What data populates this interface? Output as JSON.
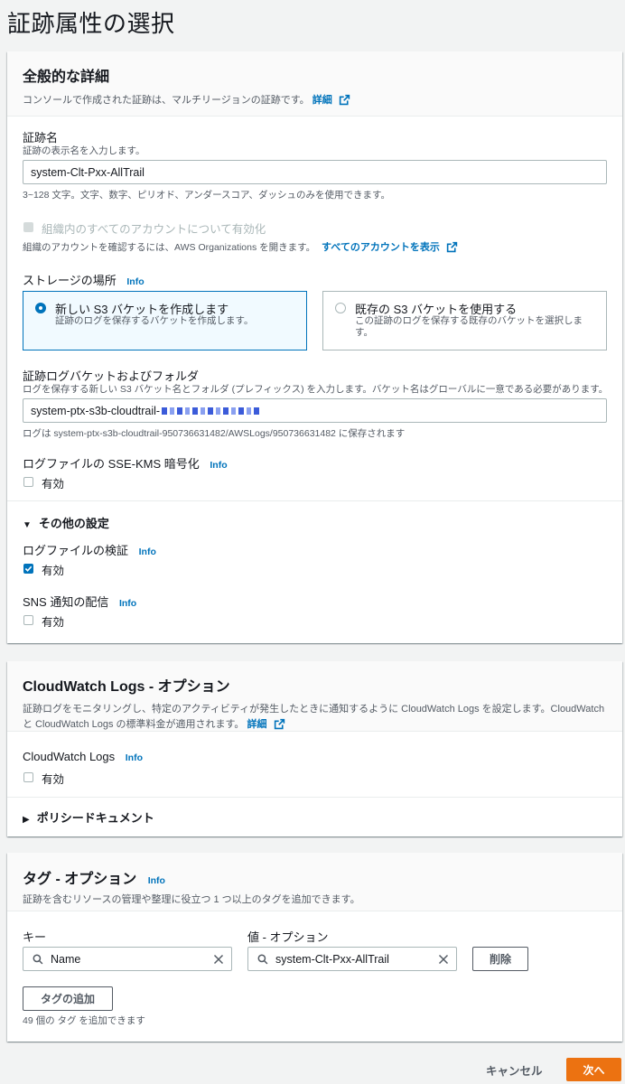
{
  "page": {
    "title": "証跡属性の選択"
  },
  "general": {
    "title": "全般的な詳細",
    "desc": "コンソールで作成された証跡は、マルチリージョンの証跡です。",
    "detail_link": "詳細",
    "trail_name_label": "証跡名",
    "trail_name_desc": "証跡の表示名を入力します。",
    "trail_name_value": "system-Clt-Pxx-AllTrail",
    "trail_name_hint": "3~128 文字。文字、数字、ピリオド、アンダースコア、ダッシュのみを使用できます。",
    "org_checkbox_label": "組織内のすべてのアカウントについて有効化",
    "org_desc": "組織のアカウントを確認するには、AWS Organizations を開きます。",
    "org_link": "すべてのアカウントを表示",
    "storage_label": "ストレージの場所",
    "info": "Info",
    "storage_options": [
      {
        "title": "新しい S3 バケットを作成します",
        "desc": "証跡のログを保存するバケットを作成します。",
        "selected": true
      },
      {
        "title": "既存の S3 バケットを使用する",
        "desc": "この証跡のログを保存する既存のバケットを選択します。",
        "selected": false
      }
    ],
    "bucket_label": "証跡ログバケットおよびフォルダ",
    "bucket_desc": "ログを保存する新しい S3 バケット名とフォルダ (プレフィックス) を入力します。バケット名はグローバルに一意である必要があります。",
    "bucket_value": "system-ptx-s3b-cloudtrail-",
    "bucket_hint": "ログは system-ptx-s3b-cloudtrail-950736631482/AWSLogs/950736631482 に保存されます",
    "sse_label": "ログファイルの SSE-KMS 暗号化",
    "enabled": "有効",
    "other_settings": "その他の設定",
    "validation_label": "ログファイルの検証",
    "sns_label": "SNS 通知の配信"
  },
  "cloudwatch": {
    "title": "CloudWatch Logs - オプション",
    "desc": "証跡ログをモニタリングし、特定のアクティビティが発生したときに通知するように CloudWatch Logs を設定します。CloudWatch と CloudWatch Logs の標準料金が適用されます。",
    "detail_link": "詳細",
    "logs_label": "CloudWatch Logs",
    "policy_doc": "ポリシードキュメント"
  },
  "tags": {
    "title": "タグ - オプション",
    "desc": "証跡を含むリソースの管理や整理に役立つ 1 つ以上のタグを追加できます。",
    "key_label": "キー",
    "value_label": "値 - オプション",
    "key_value": "Name",
    "value_value": "system-Clt-Pxx-AllTrail",
    "remove_button": "削除",
    "add_button": "タグの追加",
    "remaining": "49 個の タグ を追加できます"
  },
  "footer": {
    "cancel": "キャンセル",
    "next": "次へ"
  },
  "colors": {
    "accent": "#0073bb",
    "primary_button": "#ec7211"
  }
}
